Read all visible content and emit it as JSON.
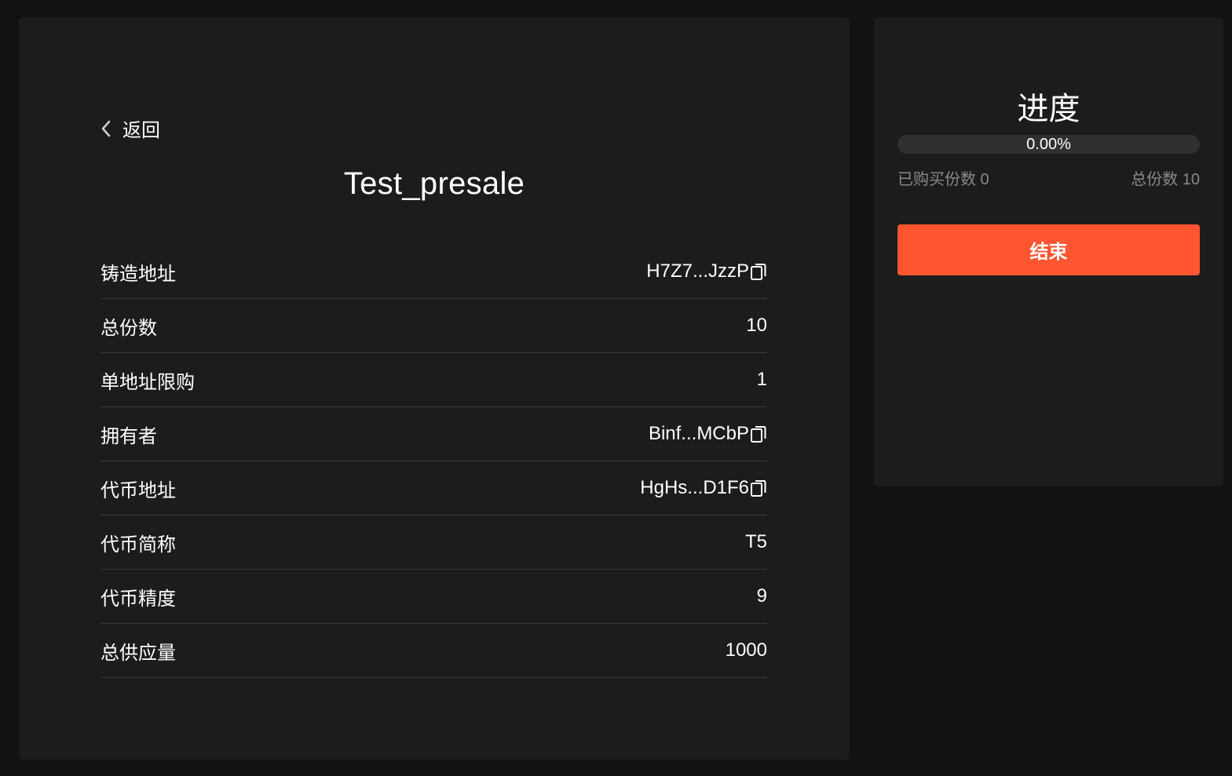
{
  "back": {
    "label": "返回",
    "icon": "chevron-left-icon"
  },
  "detail": {
    "title": "Test_presale",
    "rows": [
      {
        "label": "铸造地址",
        "value": "H7Z7...JzzP",
        "copyable": true
      },
      {
        "label": "总份数",
        "value": "10",
        "copyable": false
      },
      {
        "label": "单地址限购",
        "value": "1",
        "copyable": false
      },
      {
        "label": "拥有者",
        "value": "Binf...MCbP",
        "copyable": true
      },
      {
        "label": "代币地址",
        "value": "HgHs...D1F6",
        "copyable": true
      },
      {
        "label": "代币简称",
        "value": "T5",
        "copyable": false
      },
      {
        "label": "代币精度",
        "value": "9",
        "copyable": false
      },
      {
        "label": "总供应量",
        "value": "1000",
        "copyable": false
      }
    ]
  },
  "progress": {
    "title": "进度",
    "percent_text": "0.00%",
    "percent": 0,
    "bought_label": "已购买份数 0",
    "total_label": "总份数 10",
    "end_button_label": "结束"
  },
  "colors": {
    "background": "#111111",
    "panel": "#1c1c1c",
    "accent": "#ff5530",
    "muted_text": "#8a8a8a",
    "divider": "#3a3a3a"
  }
}
